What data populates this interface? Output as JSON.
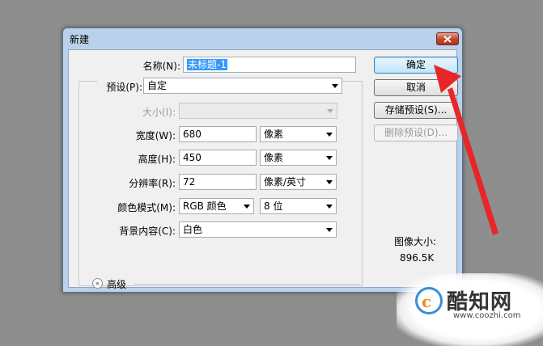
{
  "dialog": {
    "title": "新建",
    "close_glyph": "✕"
  },
  "form": {
    "name_label": "名称(N):",
    "name_value": "未标题-1",
    "preset_label": "预设(P):",
    "preset_value": "自定",
    "size_label": "大小(I):",
    "size_value": "",
    "width_label": "宽度(W):",
    "width_value": "680",
    "width_unit": "像素",
    "height_label": "高度(H):",
    "height_value": "450",
    "height_unit": "像素",
    "resolution_label": "分辨率(R):",
    "resolution_value": "72",
    "resolution_unit": "像素/英寸",
    "color_mode_label": "颜色模式(M):",
    "color_mode_value": "RGB 颜色",
    "bit_depth_value": "8 位",
    "background_label": "背景内容(C):",
    "background_value": "白色",
    "advanced_label": "高级"
  },
  "buttons": {
    "ok": "确定",
    "cancel": "取消",
    "save_preset": "存储预设(S)...",
    "delete_preset": "删除预设(D)..."
  },
  "image_size": {
    "label": "图像大小:",
    "value": "896.5K"
  },
  "watermark": {
    "name": "酷知网",
    "url": "www.coozhi.com",
    "logo_letter": "c"
  },
  "colors": {
    "annotation_arrow": "#e8262a",
    "selection": "#3399ff"
  }
}
